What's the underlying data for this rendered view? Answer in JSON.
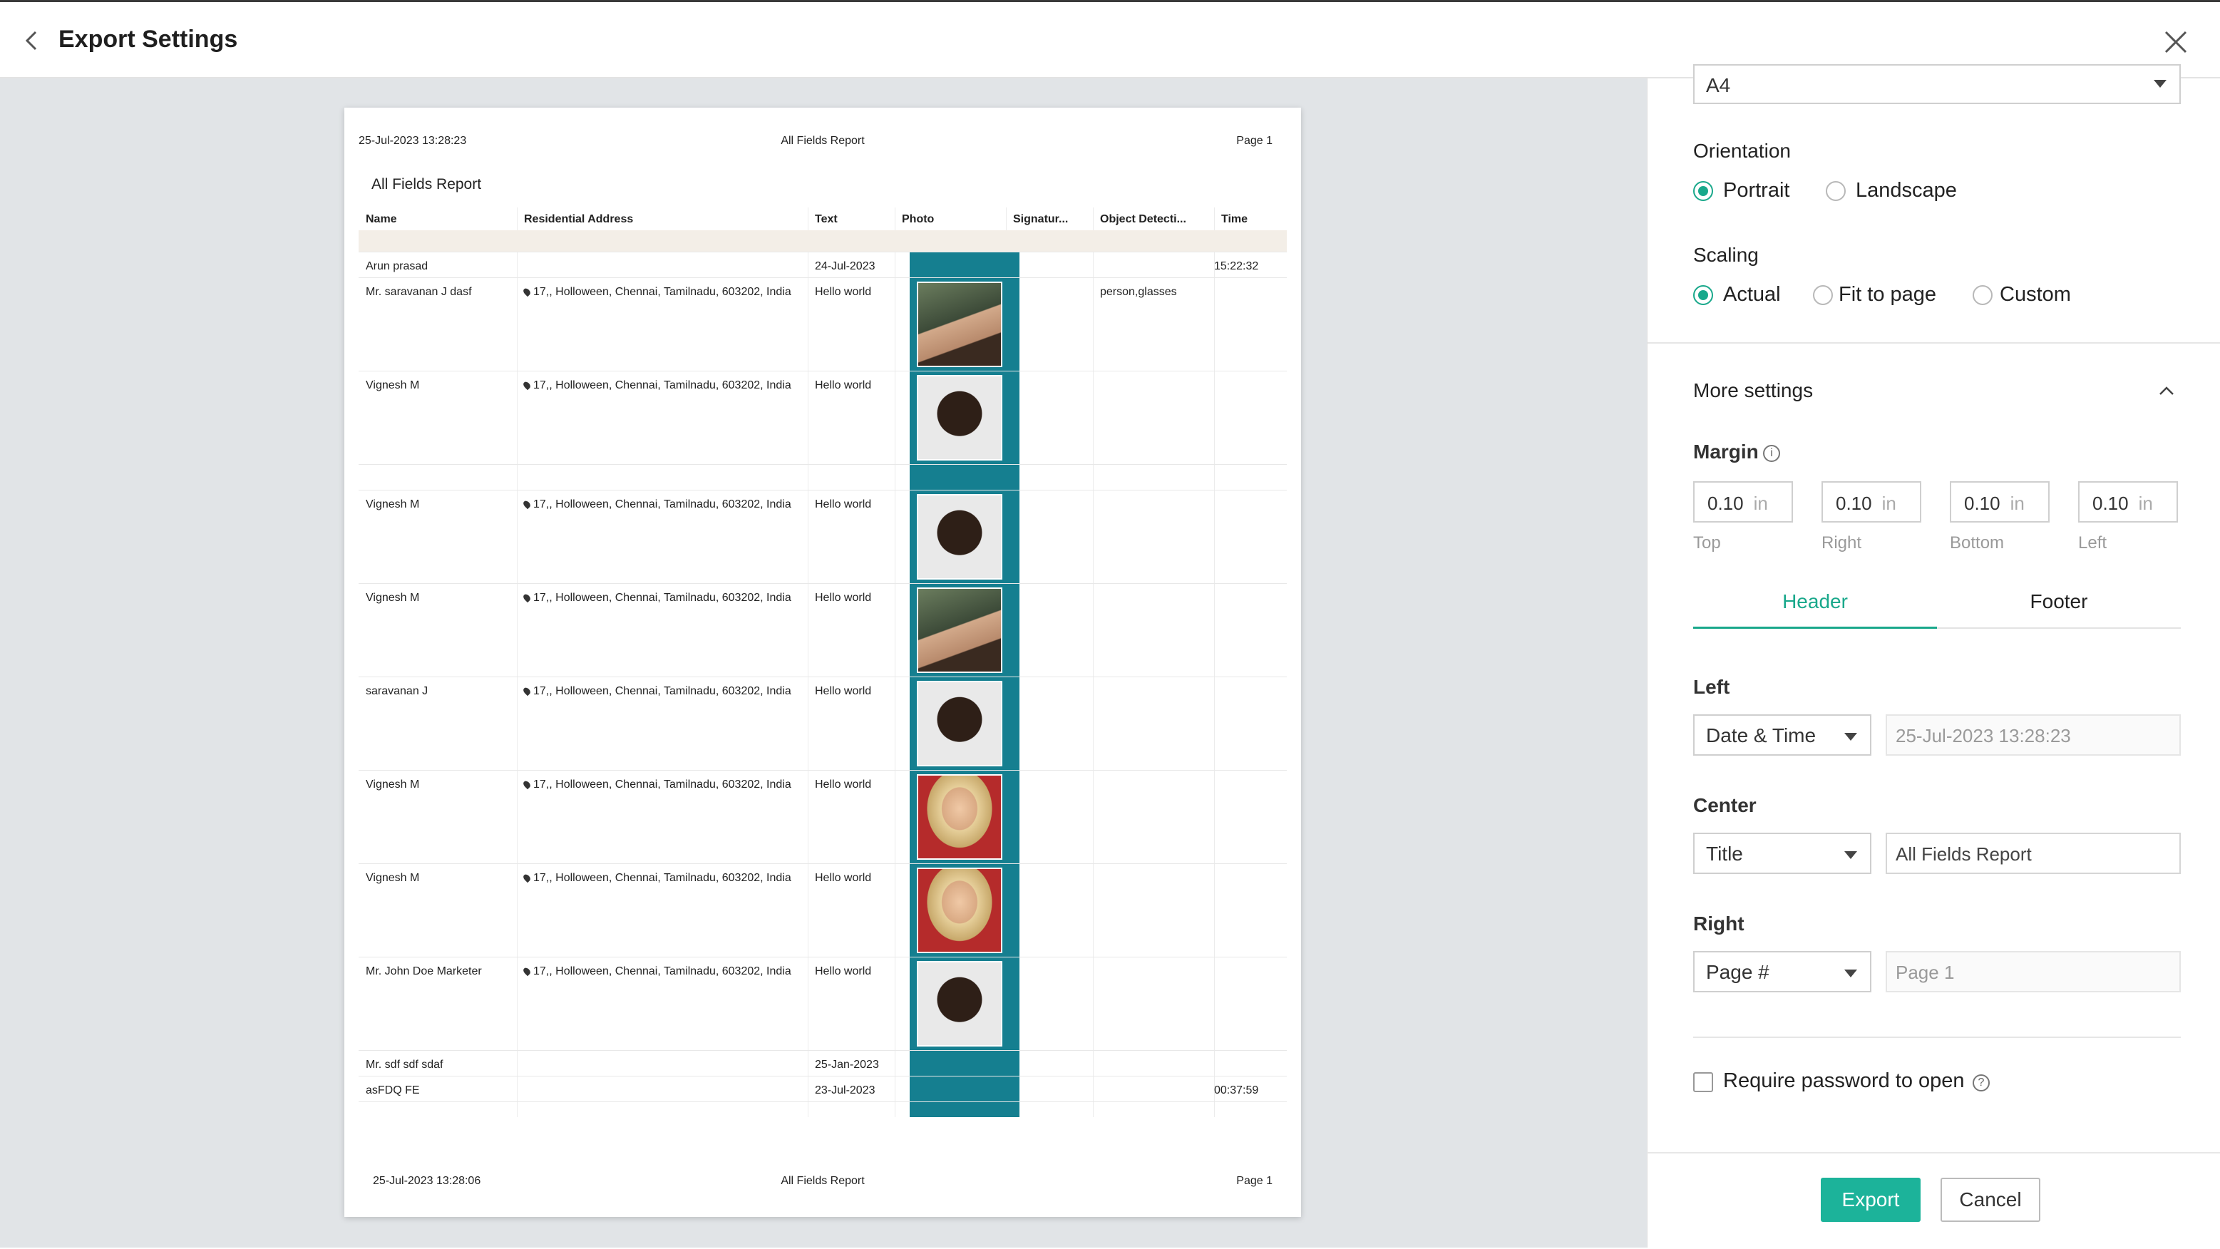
{
  "header": {
    "title": "Export Settings"
  },
  "preview": {
    "page_header": {
      "left": "25-Jul-2023 13:28:23",
      "center": "All Fields Report",
      "right": "Page 1"
    },
    "page_footer": {
      "left": "25-Jul-2023 13:28:06",
      "center": "All Fields Report",
      "right": "Page 1"
    },
    "report_title": "All Fields Report",
    "columns": [
      "Name",
      "Residential Address",
      "Text",
      "Photo",
      "Signatur...",
      "Object Detecti...",
      "Time"
    ],
    "rows": [
      {
        "name": "Arun prasad",
        "address": "",
        "text": "24-Jul-2023",
        "photo": "",
        "object": "",
        "time": "15:22:32"
      },
      {
        "name": "Mr. saravanan J dasf",
        "address": "17,, Holloween, Chennai, Tamilnadu, 603202, India",
        "text": "Hello world",
        "photo": "f1",
        "object": "person,glasses",
        "time": ""
      },
      {
        "name": "Vignesh M",
        "address": "17,, Holloween, Chennai, Tamilnadu, 603202, India",
        "text": "Hello world",
        "photo": "f2",
        "object": "",
        "time": ""
      },
      {
        "name": "",
        "address": "",
        "text": "",
        "photo": "",
        "object": "",
        "time": ""
      },
      {
        "name": "Vignesh M",
        "address": "17,, Holloween, Chennai, Tamilnadu, 603202, India",
        "text": "Hello world",
        "photo": "f2",
        "object": "",
        "time": ""
      },
      {
        "name": "Vignesh M",
        "address": "17,, Holloween, Chennai, Tamilnadu, 603202, India",
        "text": "Hello world",
        "photo": "f1",
        "object": "",
        "time": ""
      },
      {
        "name": "saravanan J",
        "address": "17,, Holloween, Chennai, Tamilnadu, 603202, India",
        "text": "Hello world",
        "photo": "f2",
        "object": "",
        "time": ""
      },
      {
        "name": "Vignesh M",
        "address": "17,, Holloween, Chennai, Tamilnadu, 603202, India",
        "text": "Hello world",
        "photo": "f3",
        "object": "",
        "time": ""
      },
      {
        "name": "Vignesh M",
        "address": "17,, Holloween, Chennai, Tamilnadu, 603202, India",
        "text": "Hello world",
        "photo": "f3",
        "object": "",
        "time": ""
      },
      {
        "name": "Mr. John Doe Marketer",
        "address": "17,, Holloween, Chennai, Tamilnadu, 603202, India",
        "text": "Hello world",
        "photo": "f2",
        "object": "",
        "time": ""
      },
      {
        "name": "Mr. sdf sdf sdaf",
        "address": "",
        "text": "25-Jan-2023",
        "photo": "",
        "object": "",
        "time": ""
      },
      {
        "name": "asFDQ FE",
        "address": "",
        "text": "23-Jul-2023",
        "photo": "",
        "object": "",
        "time": "00:37:59"
      }
    ]
  },
  "settings": {
    "paper_size": "A4",
    "orientation": {
      "label": "Orientation",
      "options": [
        "Portrait",
        "Landscape"
      ],
      "selected": "Portrait"
    },
    "scaling": {
      "label": "Scaling",
      "options": [
        "Actual",
        "Fit to page",
        "Custom"
      ],
      "selected": "Actual"
    },
    "more_settings": "More settings",
    "margin": {
      "label": "Margin",
      "unit": "in",
      "top": {
        "value": "0.10",
        "label": "Top"
      },
      "right": {
        "value": "0.10",
        "label": "Right"
      },
      "bottom": {
        "value": "0.10",
        "label": "Bottom"
      },
      "left": {
        "value": "0.10",
        "label": "Left"
      }
    },
    "tabs": [
      "Header",
      "Footer"
    ],
    "active_tab": "Header",
    "header_left": {
      "label": "Left",
      "type": "Date & Time",
      "value": "25-Jul-2023 13:28:23"
    },
    "header_center": {
      "label": "Center",
      "type": "Title",
      "value": "All Fields Report"
    },
    "header_right": {
      "label": "Right",
      "type": "Page #",
      "value": "Page 1"
    },
    "password": {
      "label": "Require password to open",
      "checked": false
    }
  },
  "actions": {
    "export": "Export",
    "cancel": "Cancel"
  },
  "colors": {
    "accent": "#19a88b",
    "export_button": "#1cb39a",
    "photo_column": "#157f90",
    "preview_background": "#e1e4e7"
  }
}
